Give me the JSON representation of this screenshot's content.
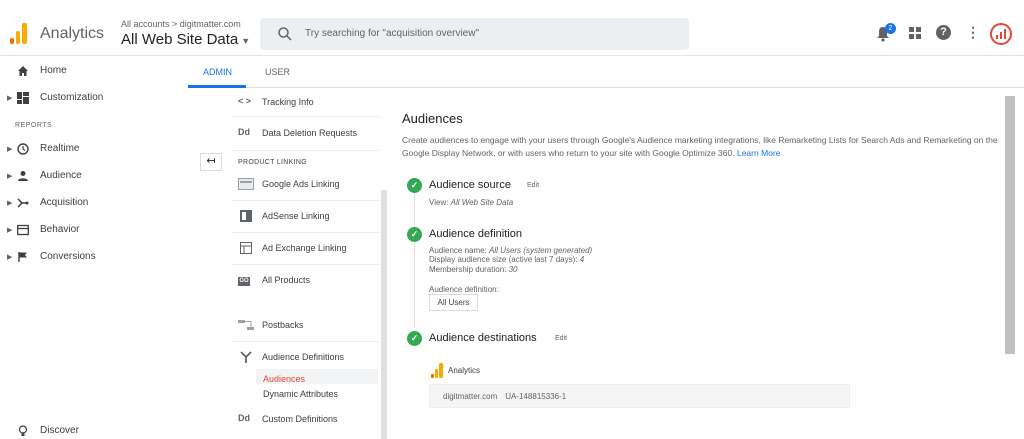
{
  "header": {
    "app_name": "Analytics",
    "account_crumb": "All accounts > digitmatter.com",
    "property": "All Web Site Data",
    "search_placeholder": "Try searching for \"acquisition overview\"",
    "notification_count": "2",
    "help": "?",
    "more": "⋮"
  },
  "leftnav": {
    "home": "Home",
    "customization": "Customization",
    "reports_heading": "REPORTS",
    "realtime": "Realtime",
    "audience": "Audience",
    "acquisition": "Acquisition",
    "behavior": "Behavior",
    "conversions": "Conversions",
    "discover": "Discover"
  },
  "tabs": {
    "admin": "ADMIN",
    "user": "USER"
  },
  "back_arrow": "↤",
  "property_column": {
    "tracking_info": "Tracking Info",
    "data_deletion": "Data Deletion Requests",
    "product_linking_heading": "PRODUCT LINKING",
    "google_ads": "Google Ads Linking",
    "adsense": "AdSense Linking",
    "ad_exchange": "Ad Exchange Linking",
    "all_products": "All Products",
    "postbacks": "Postbacks",
    "audience_definitions": "Audience Definitions",
    "audiences": "Audiences",
    "dynamic_attributes": "Dynamic Attributes",
    "custom_definitions": "Custom Definitions",
    "dd_icon": "Dd",
    "code_icon": "< >",
    "co_icon": "GO"
  },
  "main": {
    "title": "Audiences",
    "description": "Create audiences to engage with your users through Google's Audience marketing integrations, like Remarketing Lists for Search Ads and Remarketing on the Google Display Network, or with users who return to your site with Google Optimize 360.",
    "learn_more": "Learn More",
    "source": {
      "title": "Audience source",
      "edit": "Edit",
      "view_label": "View: ",
      "view_value": "All Web Site Data"
    },
    "definition": {
      "title": "Audience definition",
      "name_label": "Audience name: ",
      "name_value": "All Users (system generated)",
      "size_label": "Display audience size (active last 7 days): ",
      "size_value": "4",
      "duration_label": "Membership duration: ",
      "duration_value": "30",
      "def_label": "Audience definition:",
      "def_value": "All Users"
    },
    "destinations": {
      "title": "Audience destinations",
      "edit": "Edit",
      "product": "Analytics",
      "property": "digitmatter.com",
      "tracking_id": "UA-148815336-1"
    }
  },
  "colors": {
    "accent": "#1a73e8",
    "check": "#34a853",
    "active_red": "#e8453c",
    "logo_orange": "#f9ab00"
  }
}
